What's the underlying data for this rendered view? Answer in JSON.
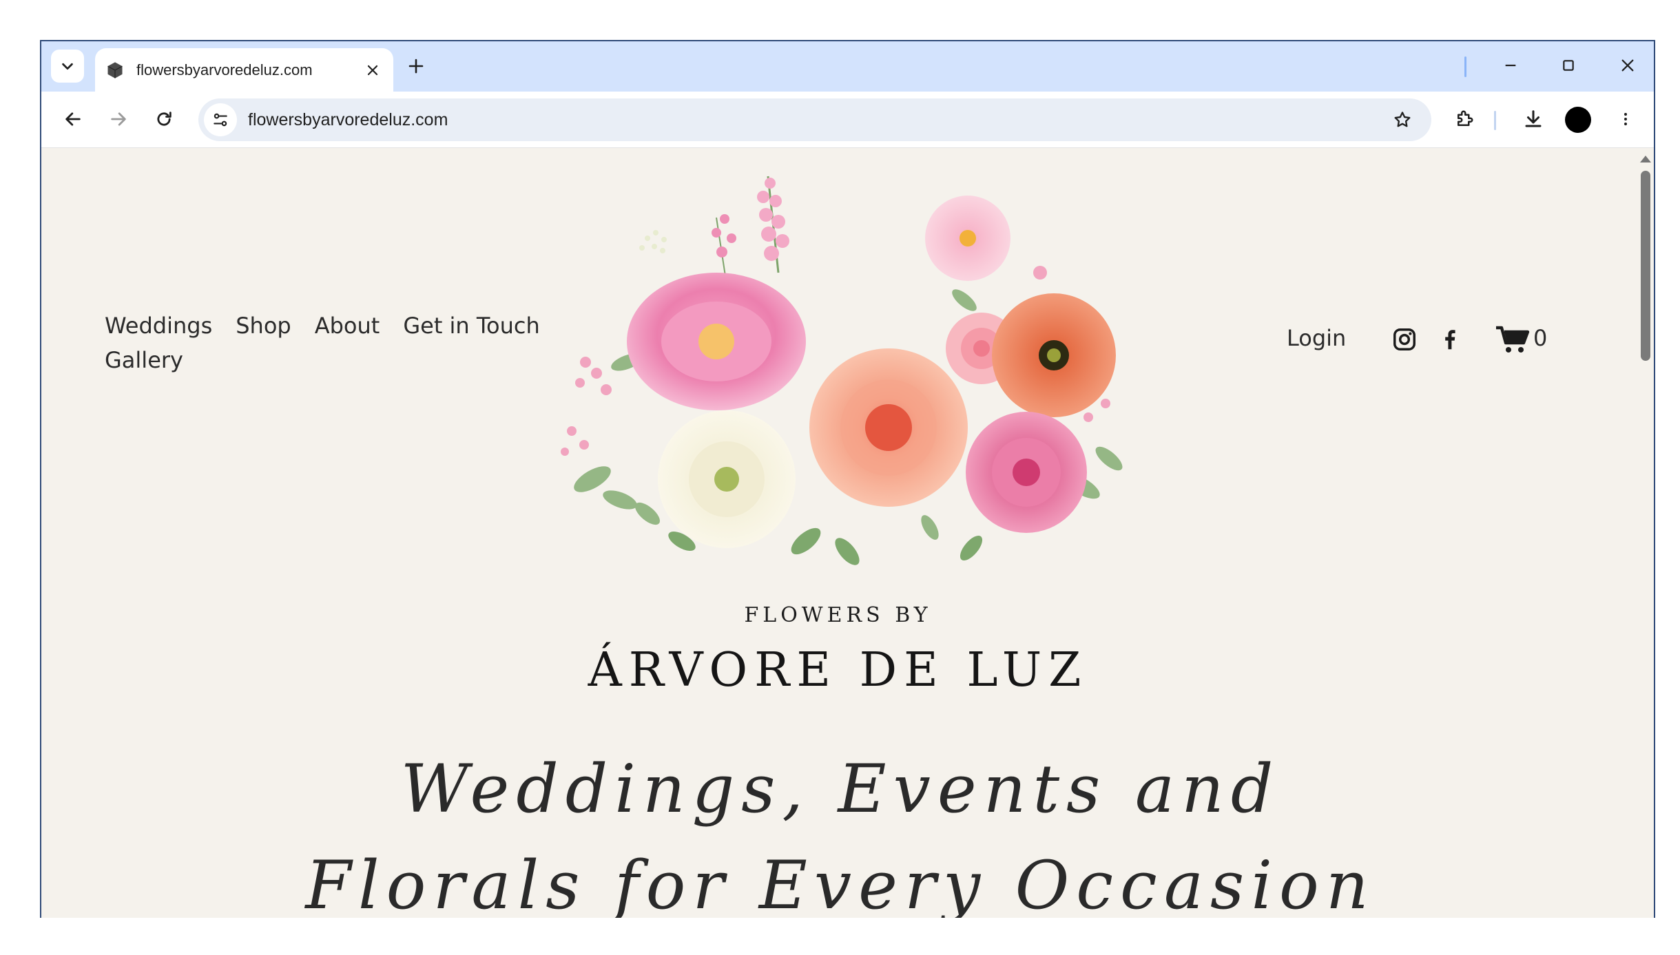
{
  "browser": {
    "tab_title": "flowersbyarvoredeluz.com",
    "url": "flowersbyarvoredeluz.com",
    "new_tab_label": "+",
    "accent_color": "#d3e3fd"
  },
  "site": {
    "nav_left": [
      "Weddings",
      "Shop",
      "About",
      "Get in Touch",
      "Gallery"
    ],
    "login_label": "Login",
    "cart_count": "0",
    "brand_small": "FLOWERS BY",
    "brand_large": "ÁRVORE DE LUZ",
    "tagline": "Weddings, Events and Florals for Every Occasion",
    "background_color": "#f5f2ec"
  }
}
